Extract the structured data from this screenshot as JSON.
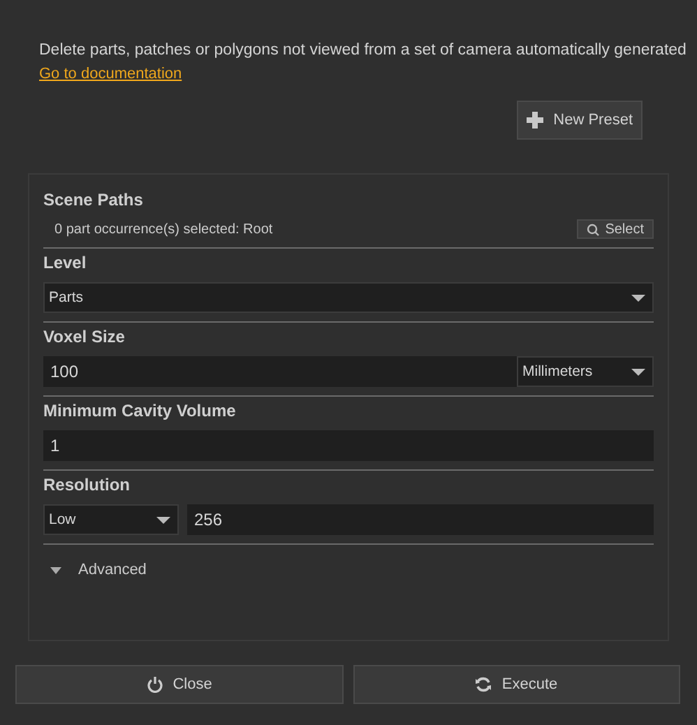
{
  "description": "Delete parts, patches or polygons not viewed from a set of camera automatically generated",
  "doc_link": "Go to documentation",
  "new_preset_button": "New Preset",
  "sections": [
    {
      "kind": "selection",
      "title": "Scene Paths",
      "text": "0 part occurrence(s) selected: Root",
      "button": "Select"
    },
    {
      "kind": "select",
      "title": "Level",
      "value": "Parts"
    },
    {
      "kind": "value_unit",
      "title": "Voxel Size",
      "value": "100",
      "unit": "Millimeters"
    },
    {
      "kind": "input",
      "title": "Minimum Cavity Volume",
      "value": "1"
    },
    {
      "kind": "select_value",
      "title": "Resolution",
      "option": "Low",
      "value": "256"
    }
  ],
  "advanced": {
    "label": "Advanced",
    "expanded": false
  },
  "buttons": [
    {
      "kind": "close",
      "label": "Close"
    },
    {
      "kind": "execute",
      "label": "Execute"
    }
  ]
}
